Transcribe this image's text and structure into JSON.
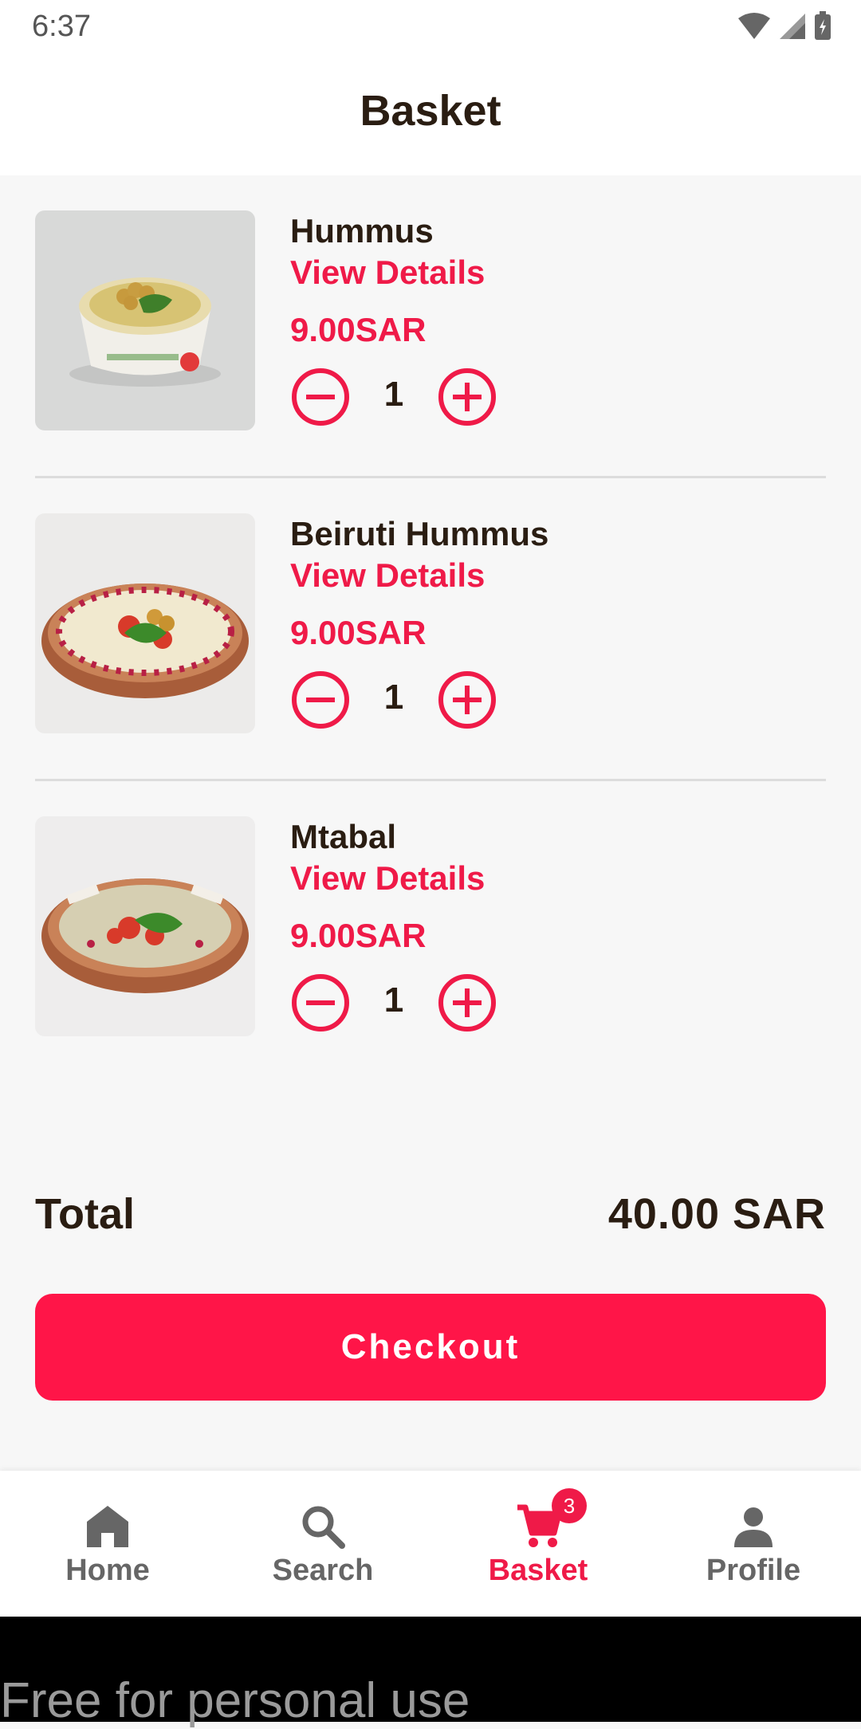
{
  "status_bar": {
    "time": "6:37"
  },
  "header": {
    "title": "Basket"
  },
  "items": [
    {
      "name": "Hummus",
      "details_label": "View Details",
      "price": "9.00SAR",
      "quantity": "1"
    },
    {
      "name": "Beiruti Hummus",
      "details_label": "View Details",
      "price": "9.00SAR",
      "quantity": "1"
    },
    {
      "name": "Mtabal",
      "details_label": "View Details",
      "price": "9.00SAR",
      "quantity": "1"
    }
  ],
  "summary": {
    "total_label": "Total",
    "total_value": "40.00 SAR"
  },
  "checkout": {
    "label": "Checkout"
  },
  "nav": {
    "items": [
      {
        "label": "Home",
        "icon": "home-icon"
      },
      {
        "label": "Search",
        "icon": "search-icon"
      },
      {
        "label": "Basket",
        "icon": "cart-icon",
        "badge": "3"
      },
      {
        "label": "Profile",
        "icon": "person-icon"
      }
    ],
    "active": "Basket"
  },
  "watermark": {
    "text": "Free for personal use"
  },
  "colors": {
    "accent": "#ef1a48",
    "checkout": "#ff1548",
    "text": "#2a1d12",
    "background": "#f7f7f7"
  }
}
